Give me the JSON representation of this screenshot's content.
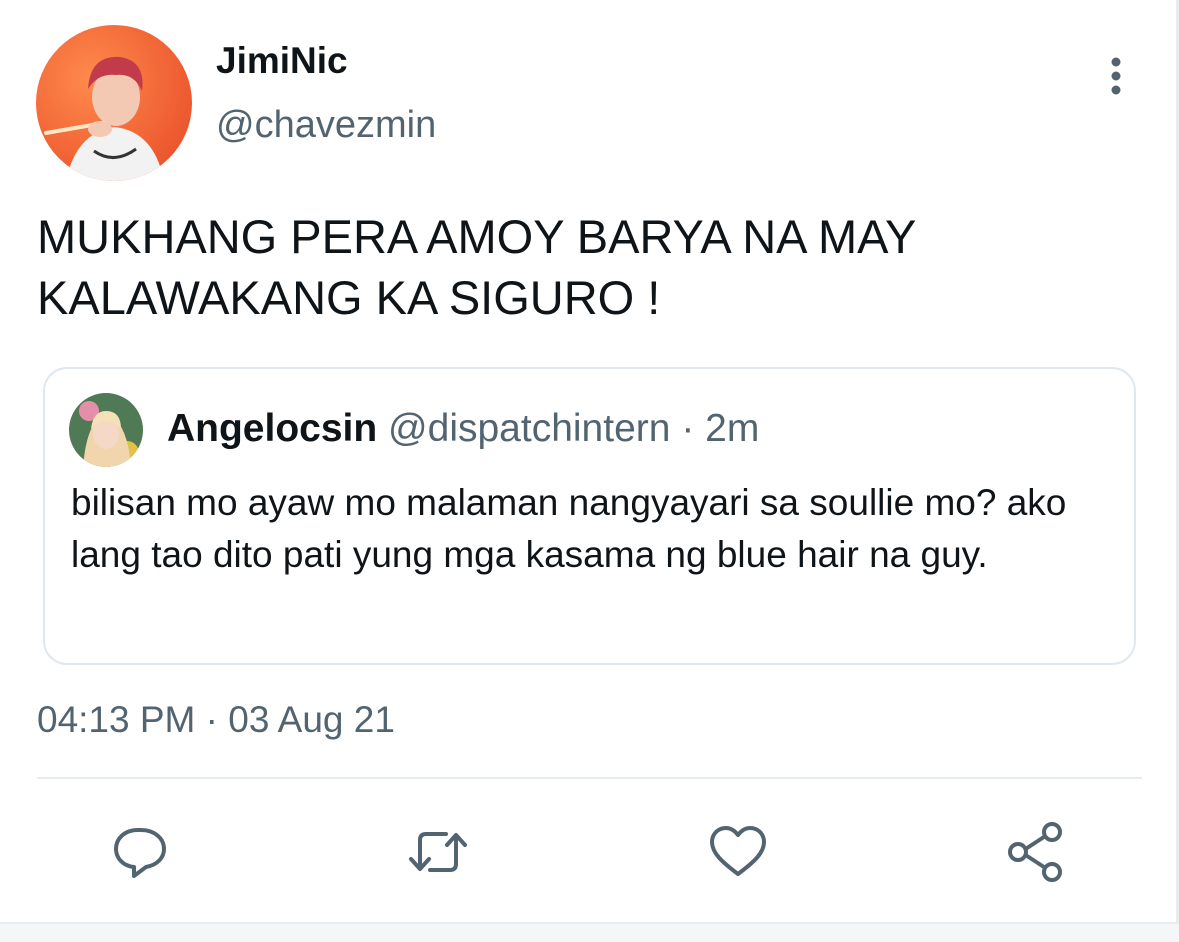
{
  "tweet": {
    "author": {
      "name": "JimiNic",
      "handle": "@chavezmin"
    },
    "text": "MUKHANG PERA AMOY BARYA NA MAY KALAWAKANG KA SIGURO !",
    "timestamp": "04:13 PM · 03 Aug 21"
  },
  "quoted_tweet": {
    "name": "Angelocsin",
    "handle": "@dispatchintern",
    "separator": "·",
    "time": "2m",
    "text": "bilisan mo ayaw mo malaman nangyayari sa soullie mo? ako lang tao dito pati yung mga kasama ng blue hair na guy."
  },
  "actions": {
    "reply": "reply-icon",
    "retweet": "retweet-icon",
    "like": "heart-icon",
    "share": "share-icon"
  },
  "colors": {
    "primary_text": "#0f1419",
    "secondary_text": "#536471",
    "border": "#e1e8ed",
    "avatar_bg": "#f06a3c"
  }
}
